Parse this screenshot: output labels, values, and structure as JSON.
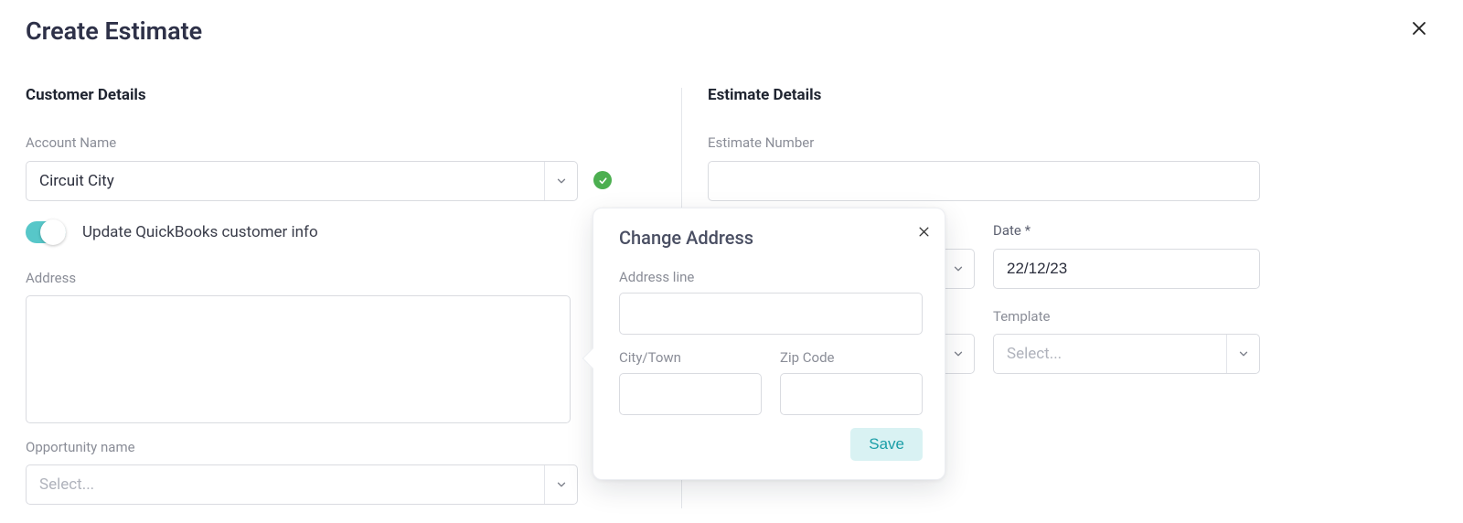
{
  "title": "Create Estimate",
  "sections": {
    "customer": "Customer Details",
    "estimate": "Estimate Details"
  },
  "customer": {
    "account_label": "Account Name",
    "account_value": "Circuit City",
    "update_qb_label": "Update QuickBooks customer info",
    "update_qb_on": true,
    "address_label": "Address",
    "address_value": "",
    "opportunity_label": "Opportunity name",
    "opportunity_placeholder": "Select..."
  },
  "estimate": {
    "number_label": "Estimate Number",
    "number_value": "",
    "date_label": "Date *",
    "date_value": "22/12/23",
    "template_label": "Template",
    "template_placeholder": "Select..."
  },
  "popover": {
    "title": "Change Address",
    "address_line_label": "Address line",
    "city_label": "City/Town",
    "zip_label": "Zip Code",
    "save_label": "Save"
  }
}
